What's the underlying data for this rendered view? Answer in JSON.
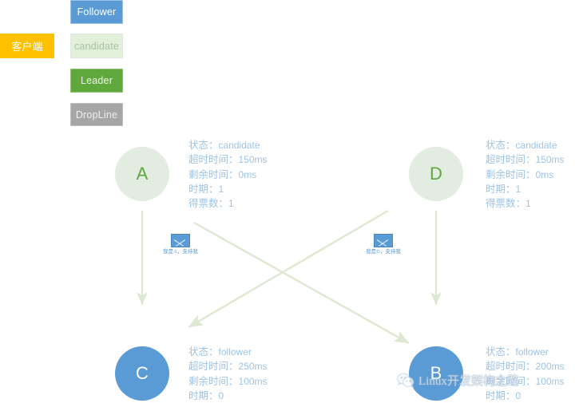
{
  "legend": {
    "items": [
      {
        "key": "client",
        "label": "客户端",
        "color": "#ffc000"
      },
      {
        "key": "follower",
        "label": "Follower",
        "color": "#5b9bd5"
      },
      {
        "key": "candidate",
        "label": "candidate",
        "color": "#e2efda"
      },
      {
        "key": "leader",
        "label": "Leader",
        "color": "#5fa83c"
      },
      {
        "key": "dropline",
        "label": "DropLine",
        "color": "#a6a6a6"
      }
    ]
  },
  "nodes": [
    {
      "id": "a",
      "label": "A",
      "role": "candidate",
      "color": "#e3ece0",
      "text_color": "#5fa83c"
    },
    {
      "id": "d",
      "label": "D",
      "role": "candidate",
      "color": "#e3ece0",
      "text_color": "#5fa83c"
    },
    {
      "id": "c",
      "label": "C",
      "role": "follower",
      "color": "#5b9bd5",
      "text_color": "#ffffff"
    },
    {
      "id": "b",
      "label": "B",
      "role": "follower",
      "color": "#5b9bd5",
      "text_color": "#ffffff"
    }
  ],
  "info_panels": {
    "a": {
      "state_key": "状态：",
      "state_value": "candidate",
      "timeout_key": "超时时间：",
      "timeout_value": "150ms",
      "remain_key": "剩余时间：",
      "remain_value": "0ms",
      "term_key": "时期：",
      "term_value": "1",
      "votes_key": "得票数：",
      "votes_value": "1"
    },
    "d": {
      "state_key": "状态：",
      "state_value": "candidate",
      "timeout_key": "超时时间：",
      "timeout_value": "150ms",
      "remain_key": "剩余时间：",
      "remain_value": "0ms",
      "term_key": "时期：",
      "term_value": "1",
      "votes_key": "得票数：",
      "votes_value": "1"
    },
    "c": {
      "state_key": "状态：",
      "state_value": "follower",
      "timeout_key": "超时时间：",
      "timeout_value": "250ms",
      "remain_key": "剩余时间：",
      "remain_value": "100ms",
      "term_key": "时期：",
      "term_value": "0"
    },
    "b": {
      "state_key": "状态：",
      "state_value": "follower",
      "timeout_key": "超时时间：",
      "timeout_value": "200ms",
      "remain_key": "剩余时间：",
      "remain_value": "100ms",
      "term_key": "时期：",
      "term_value": "0"
    }
  },
  "messages": [
    {
      "id": "a",
      "icon": "envelope-icon",
      "label": "我是A，支持我"
    },
    {
      "id": "d",
      "icon": "envelope-icon",
      "label": "我是D，支持我"
    }
  ],
  "arrows": {
    "color": "#dde8d2",
    "edges": [
      {
        "from": "A",
        "to": "C",
        "kind": "vertical"
      },
      {
        "from": "D",
        "to": "B",
        "kind": "vertical"
      },
      {
        "from": "A",
        "to": "B",
        "kind": "diagonal"
      },
      {
        "from": "D",
        "to": "C",
        "kind": "diagonal"
      }
    ]
  },
  "watermark": {
    "icon": "wechat-icon",
    "text": "Linux开发架构之路"
  }
}
